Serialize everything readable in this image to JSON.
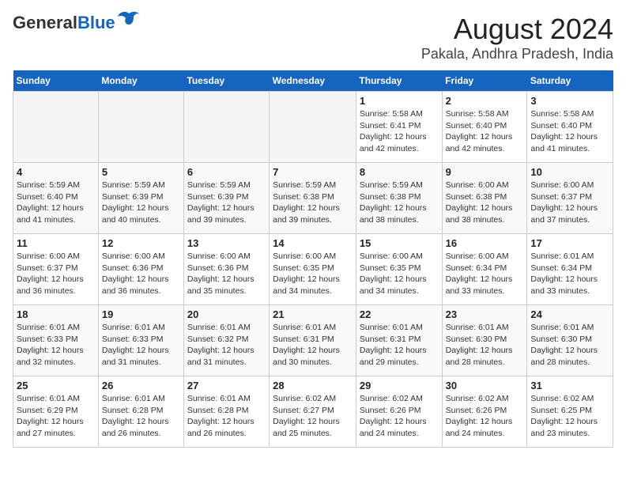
{
  "logo": {
    "general": "General",
    "blue": "Blue"
  },
  "title": "August 2024",
  "subtitle": "Pakala, Andhra Pradesh, India",
  "days_of_week": [
    "Sunday",
    "Monday",
    "Tuesday",
    "Wednesday",
    "Thursday",
    "Friday",
    "Saturday"
  ],
  "weeks": [
    [
      {
        "day": "",
        "info": ""
      },
      {
        "day": "",
        "info": ""
      },
      {
        "day": "",
        "info": ""
      },
      {
        "day": "",
        "info": ""
      },
      {
        "day": "1",
        "info": "Sunrise: 5:58 AM\nSunset: 6:41 PM\nDaylight: 12 hours\nand 42 minutes."
      },
      {
        "day": "2",
        "info": "Sunrise: 5:58 AM\nSunset: 6:40 PM\nDaylight: 12 hours\nand 42 minutes."
      },
      {
        "day": "3",
        "info": "Sunrise: 5:58 AM\nSunset: 6:40 PM\nDaylight: 12 hours\nand 41 minutes."
      }
    ],
    [
      {
        "day": "4",
        "info": "Sunrise: 5:59 AM\nSunset: 6:40 PM\nDaylight: 12 hours\nand 41 minutes."
      },
      {
        "day": "5",
        "info": "Sunrise: 5:59 AM\nSunset: 6:39 PM\nDaylight: 12 hours\nand 40 minutes."
      },
      {
        "day": "6",
        "info": "Sunrise: 5:59 AM\nSunset: 6:39 PM\nDaylight: 12 hours\nand 39 minutes."
      },
      {
        "day": "7",
        "info": "Sunrise: 5:59 AM\nSunset: 6:38 PM\nDaylight: 12 hours\nand 39 minutes."
      },
      {
        "day": "8",
        "info": "Sunrise: 5:59 AM\nSunset: 6:38 PM\nDaylight: 12 hours\nand 38 minutes."
      },
      {
        "day": "9",
        "info": "Sunrise: 6:00 AM\nSunset: 6:38 PM\nDaylight: 12 hours\nand 38 minutes."
      },
      {
        "day": "10",
        "info": "Sunrise: 6:00 AM\nSunset: 6:37 PM\nDaylight: 12 hours\nand 37 minutes."
      }
    ],
    [
      {
        "day": "11",
        "info": "Sunrise: 6:00 AM\nSunset: 6:37 PM\nDaylight: 12 hours\nand 36 minutes."
      },
      {
        "day": "12",
        "info": "Sunrise: 6:00 AM\nSunset: 6:36 PM\nDaylight: 12 hours\nand 36 minutes."
      },
      {
        "day": "13",
        "info": "Sunrise: 6:00 AM\nSunset: 6:36 PM\nDaylight: 12 hours\nand 35 minutes."
      },
      {
        "day": "14",
        "info": "Sunrise: 6:00 AM\nSunset: 6:35 PM\nDaylight: 12 hours\nand 34 minutes."
      },
      {
        "day": "15",
        "info": "Sunrise: 6:00 AM\nSunset: 6:35 PM\nDaylight: 12 hours\nand 34 minutes."
      },
      {
        "day": "16",
        "info": "Sunrise: 6:00 AM\nSunset: 6:34 PM\nDaylight: 12 hours\nand 33 minutes."
      },
      {
        "day": "17",
        "info": "Sunrise: 6:01 AM\nSunset: 6:34 PM\nDaylight: 12 hours\nand 33 minutes."
      }
    ],
    [
      {
        "day": "18",
        "info": "Sunrise: 6:01 AM\nSunset: 6:33 PM\nDaylight: 12 hours\nand 32 minutes."
      },
      {
        "day": "19",
        "info": "Sunrise: 6:01 AM\nSunset: 6:33 PM\nDaylight: 12 hours\nand 31 minutes."
      },
      {
        "day": "20",
        "info": "Sunrise: 6:01 AM\nSunset: 6:32 PM\nDaylight: 12 hours\nand 31 minutes."
      },
      {
        "day": "21",
        "info": "Sunrise: 6:01 AM\nSunset: 6:31 PM\nDaylight: 12 hours\nand 30 minutes."
      },
      {
        "day": "22",
        "info": "Sunrise: 6:01 AM\nSunset: 6:31 PM\nDaylight: 12 hours\nand 29 minutes."
      },
      {
        "day": "23",
        "info": "Sunrise: 6:01 AM\nSunset: 6:30 PM\nDaylight: 12 hours\nand 28 minutes."
      },
      {
        "day": "24",
        "info": "Sunrise: 6:01 AM\nSunset: 6:30 PM\nDaylight: 12 hours\nand 28 minutes."
      }
    ],
    [
      {
        "day": "25",
        "info": "Sunrise: 6:01 AM\nSunset: 6:29 PM\nDaylight: 12 hours\nand 27 minutes."
      },
      {
        "day": "26",
        "info": "Sunrise: 6:01 AM\nSunset: 6:28 PM\nDaylight: 12 hours\nand 26 minutes."
      },
      {
        "day": "27",
        "info": "Sunrise: 6:01 AM\nSunset: 6:28 PM\nDaylight: 12 hours\nand 26 minutes."
      },
      {
        "day": "28",
        "info": "Sunrise: 6:02 AM\nSunset: 6:27 PM\nDaylight: 12 hours\nand 25 minutes."
      },
      {
        "day": "29",
        "info": "Sunrise: 6:02 AM\nSunset: 6:26 PM\nDaylight: 12 hours\nand 24 minutes."
      },
      {
        "day": "30",
        "info": "Sunrise: 6:02 AM\nSunset: 6:26 PM\nDaylight: 12 hours\nand 24 minutes."
      },
      {
        "day": "31",
        "info": "Sunrise: 6:02 AM\nSunset: 6:25 PM\nDaylight: 12 hours\nand 23 minutes."
      }
    ]
  ]
}
